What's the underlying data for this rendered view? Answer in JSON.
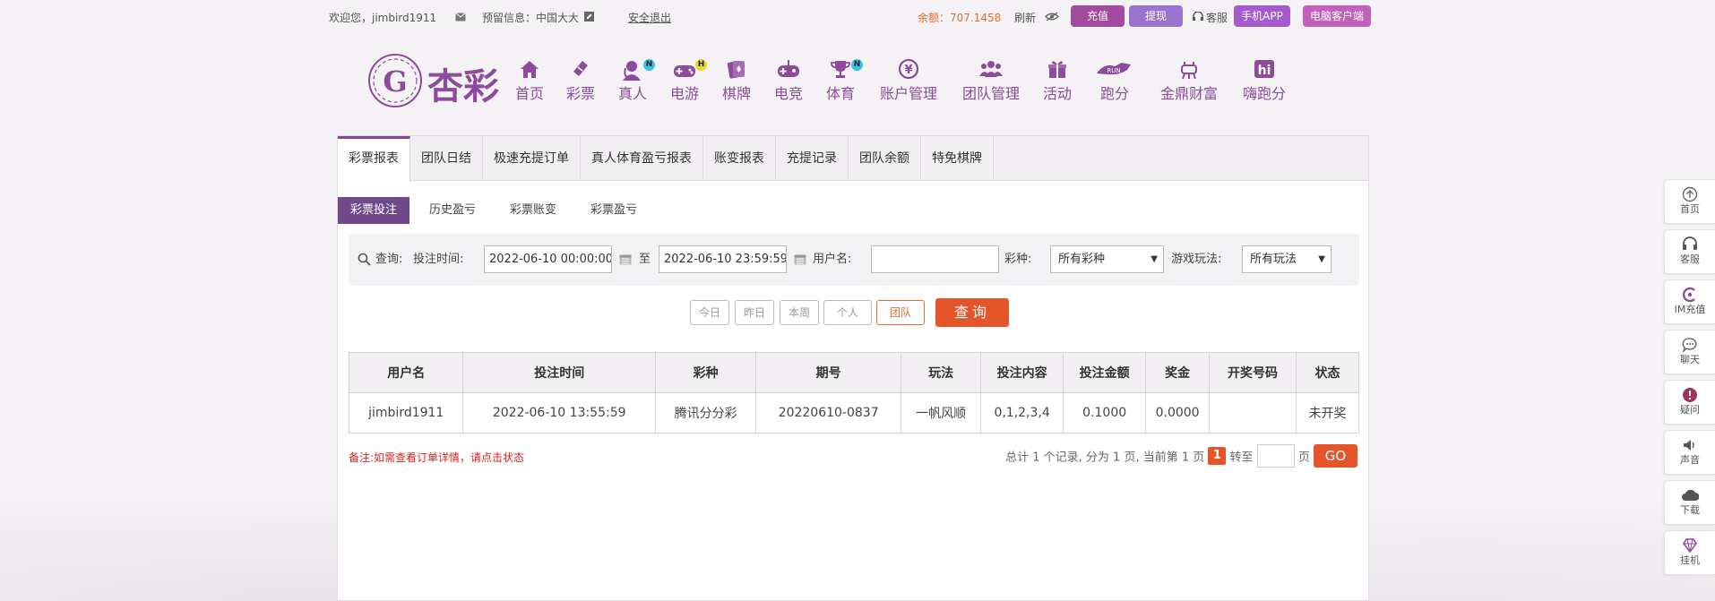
{
  "topbar": {
    "welcome": "欢迎您，jimbird1911",
    "reserved_info": "预留信息：中国大大",
    "logout": "安全退出",
    "balance": "余额：707.1458",
    "refresh": "刷新",
    "recharge": "充值",
    "withdraw": "提现",
    "service": "客服",
    "mobile_app": "手机APP",
    "pc_client": "电脑客户端"
  },
  "brand": {
    "logo_text": "杏彩"
  },
  "nav": [
    {
      "label": "首页",
      "icon": "home-icon"
    },
    {
      "label": "彩票",
      "icon": "lottery-ticket-icon"
    },
    {
      "label": "真人",
      "icon": "live-dealer-icon",
      "badge": "N"
    },
    {
      "label": "电游",
      "icon": "gamepad-icon",
      "badge": "H"
    },
    {
      "label": "棋牌",
      "icon": "cards-icon"
    },
    {
      "label": "电竞",
      "icon": "esports-controller-icon"
    },
    {
      "label": "体育",
      "icon": "trophy-icon",
      "badge": "N"
    },
    {
      "label": "账户管理",
      "icon": "account-yuan-icon"
    },
    {
      "label": "团队管理",
      "icon": "team-icon"
    },
    {
      "label": "活动",
      "icon": "gift-icon"
    },
    {
      "label": "跑分",
      "icon": "running-score-icon"
    },
    {
      "label": "金鼎财富",
      "icon": "tripod-wealth-icon"
    },
    {
      "label": "嗨跑分",
      "icon": "hi-score-icon"
    }
  ],
  "tabs": [
    "彩票报表",
    "团队日结",
    "极速充提订单",
    "真人体育盈亏报表",
    "账变报表",
    "充提记录",
    "团队余额",
    "特免棋牌"
  ],
  "subtabs": [
    "彩票投注",
    "历史盈亏",
    "彩票账变",
    "彩票盈亏"
  ],
  "query": {
    "label": "查询:",
    "time_label": "投注时间:",
    "start_time": "2022-06-10 00:00:00",
    "to": "至",
    "end_time": "2022-06-10 23:59:59",
    "username_label": "用户名:",
    "username_value": "",
    "lottery_label": "彩种:",
    "lottery_value": "所有彩种",
    "play_label": "游戏玩法:",
    "play_value": "所有玩法"
  },
  "quick_buttons": [
    "今日",
    "昨日",
    "本周",
    "个人",
    "团队"
  ],
  "search_button": "查询",
  "table": {
    "headers": [
      "用户名",
      "投注时间",
      "彩种",
      "期号",
      "玩法",
      "投注内容",
      "投注金额",
      "奖金",
      "开奖号码",
      "状态"
    ],
    "rows": [
      [
        "jimbird1911",
        "2022-06-10 13:55:59",
        "腾讯分分彩",
        "20220610-0837",
        "一帆风顺",
        "0,1,2,3,4",
        "0.1000",
        "0.0000",
        "",
        "未开奖"
      ]
    ]
  },
  "note": "备注:如需查看订单详情，请点击状态",
  "pager": {
    "summary": "总计 1 个记录, 分为 1 页, 当前第 1 页",
    "current": "1",
    "goto": "转至",
    "page_unit": "页",
    "go": "GO"
  },
  "float_bar": [
    {
      "label": "首页",
      "icon": "arrow-up-icon"
    },
    {
      "label": "客服",
      "icon": "headset-icon"
    },
    {
      "label": "IM充值",
      "icon": "im-recharge-icon"
    },
    {
      "label": "聊天",
      "icon": "chat-bubble-icon"
    },
    {
      "label": "疑问",
      "icon": "question-icon"
    },
    {
      "label": "声音",
      "icon": "speaker-icon"
    },
    {
      "label": "下载",
      "icon": "cloud-download-icon"
    },
    {
      "label": "挂机",
      "icon": "diamond-icon"
    }
  ],
  "colors": {
    "brand_purple": "#8e4a9c",
    "recharge": "#a24a9e",
    "withdraw": "#9a72cf",
    "app": "#a65ad0",
    "pc_client": "#c261bb",
    "accent_orange": "#e5552a",
    "status_green": "#2a8a20"
  }
}
